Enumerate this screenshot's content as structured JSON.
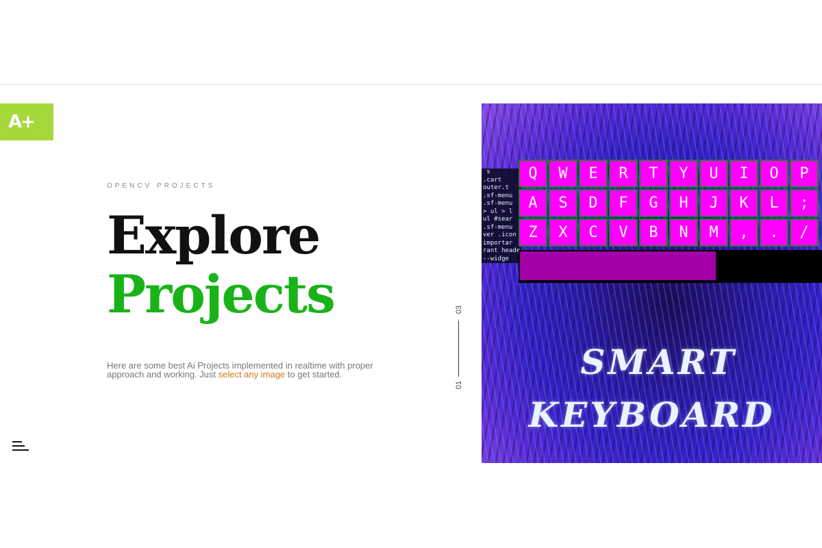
{
  "brand": {
    "logo_text": "A+",
    "accent": "#a6d83a"
  },
  "hero": {
    "eyebrow": "OPENCV PROJECTS",
    "title_line1": "Explore",
    "title_line2": "Projects",
    "title_line2_color": "#19b319",
    "description_before": "Here are some best Ai Projects implemented in realtime with proper approach and working. Just ",
    "description_link": "select any image",
    "description_after": " to get started.",
    "link_color": "#d2781a"
  },
  "pager": {
    "current": "01",
    "total": "03"
  },
  "menu": {
    "icon": "hamburger-menu-icon"
  },
  "project_image": {
    "code_lines": [
      " s",
      ".cart",
      "outer.t",
      ".sf-menu",
      ".sf-menu",
      "> ul > l",
      "ul #sear",
      ".sf-menu",
      "ver .icon",
      "importar",
      "rant heade",
      "--widge"
    ],
    "keyboard_rows": [
      [
        "Q",
        "W",
        "E",
        "R",
        "T",
        "Y",
        "U",
        "I",
        "O",
        "P"
      ],
      [
        "A",
        "S",
        "D",
        "F",
        "G",
        "H",
        "J",
        "K",
        "L",
        ";"
      ],
      [
        "Z",
        "X",
        "C",
        "V",
        "B",
        "N",
        "M",
        ",",
        ".",
        "/"
      ]
    ],
    "title_line1": "SMART",
    "title_line2": "KEYBOARD"
  }
}
